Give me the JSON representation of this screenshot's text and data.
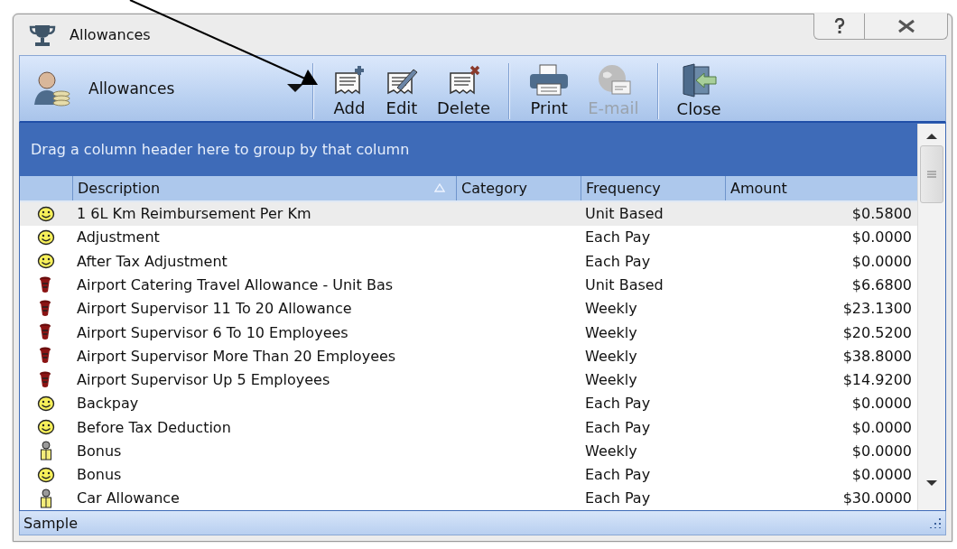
{
  "window": {
    "title": "Allowances"
  },
  "toolbar": {
    "selector": {
      "label": "Allowances"
    },
    "groups": [
      [
        {
          "label": "Add",
          "kind": "add",
          "disabled": false
        },
        {
          "label": "Edit",
          "kind": "edit",
          "disabled": false
        },
        {
          "label": "Delete",
          "kind": "delete",
          "disabled": false
        }
      ],
      [
        {
          "label": "Print",
          "kind": "print",
          "disabled": false
        },
        {
          "label": "E-mail",
          "kind": "email",
          "disabled": true
        }
      ],
      [
        {
          "label": "Close",
          "kind": "close",
          "disabled": false
        }
      ]
    ]
  },
  "group_panel": {
    "hint": "Drag a column header here to group by that column"
  },
  "table": {
    "columns": [
      {
        "label": "Description",
        "sorted": true
      },
      {
        "label": "Category",
        "sorted": false
      },
      {
        "label": "Frequency",
        "sorted": false
      },
      {
        "label": "Amount",
        "sorted": false
      }
    ],
    "rows": [
      {
        "kind": "smiley",
        "selected": true,
        "cells": [
          "1 6L Km Reimbursement Per Km",
          "",
          "Unit Based",
          "$0.5800"
        ]
      },
      {
        "kind": "smiley",
        "selected": false,
        "cells": [
          "Adjustment",
          "",
          "Each Pay",
          "$0.0000"
        ]
      },
      {
        "kind": "smiley",
        "selected": false,
        "cells": [
          "After Tax Adjustment",
          "",
          "Each Pay",
          "$0.0000"
        ]
      },
      {
        "kind": "cylinder",
        "selected": false,
        "cells": [
          "Airport Catering Travel Allowance - Unit Bas",
          "",
          "Unit Based",
          "$6.6800"
        ]
      },
      {
        "kind": "cylinder",
        "selected": false,
        "cells": [
          "Airport Supervisor 11 To 20 Allowance",
          "",
          "Weekly",
          "$23.1300"
        ]
      },
      {
        "kind": "cylinder",
        "selected": false,
        "cells": [
          "Airport Supervisor 6 To 10 Employees",
          "",
          "Weekly",
          "$20.5200"
        ]
      },
      {
        "kind": "cylinder",
        "selected": false,
        "cells": [
          "Airport Supervisor More Than 20 Employees",
          "",
          "Weekly",
          "$38.8000"
        ]
      },
      {
        "kind": "cylinder",
        "selected": false,
        "cells": [
          "Airport Supervisor Up 5 Employees",
          "",
          "Weekly",
          "$14.9200"
        ]
      },
      {
        "kind": "smiley",
        "selected": false,
        "cells": [
          "Backpay",
          "",
          "Each Pay",
          "$0.0000"
        ]
      },
      {
        "kind": "smiley",
        "selected": false,
        "cells": [
          "Before Tax Deduction",
          "",
          "Each Pay",
          "$0.0000"
        ]
      },
      {
        "kind": "person",
        "selected": false,
        "cells": [
          "Bonus",
          "",
          "Weekly",
          "$0.0000"
        ]
      },
      {
        "kind": "smiley",
        "selected": false,
        "cells": [
          "Bonus",
          "",
          "Each Pay",
          "$0.0000"
        ]
      },
      {
        "kind": "person",
        "selected": false,
        "cells": [
          "Car Allowance",
          "",
          "Each Pay",
          "$30.0000"
        ]
      }
    ]
  },
  "status_bar": {
    "text": "Sample"
  }
}
